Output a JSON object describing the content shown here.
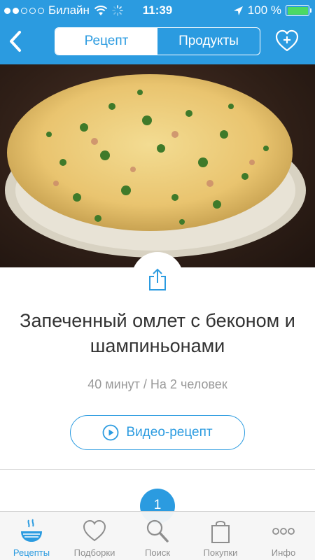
{
  "status_bar": {
    "carrier": "Билайн",
    "time": "11:39",
    "battery": "100 %",
    "battery_level": 1.0
  },
  "header": {
    "tabs": [
      {
        "label": "Рецепт",
        "active": true
      },
      {
        "label": "Продукты",
        "active": false
      }
    ],
    "back_icon": "chevron-left-icon",
    "favorite_icon": "heart-plus-icon"
  },
  "recipe": {
    "title": "Запеченный омлет с беконом и шампиньонами",
    "meta": "40 минут / На 2 человек",
    "video_button": "Видео-рецепт",
    "step_number": "1"
  },
  "tab_bar": {
    "items": [
      {
        "label": "Рецепты",
        "icon": "recipes-bowl-icon",
        "active": true
      },
      {
        "label": "Подборки",
        "icon": "heart-icon",
        "active": false
      },
      {
        "label": "Поиск",
        "icon": "search-icon",
        "active": false
      },
      {
        "label": "Покупки",
        "icon": "shopping-bag-icon",
        "active": false
      },
      {
        "label": "Инфо",
        "icon": "more-dots-icon",
        "active": false
      }
    ]
  },
  "colors": {
    "accent": "#2b9be0",
    "text": "#333333",
    "muted": "#999999",
    "battery": "#4cd964"
  }
}
